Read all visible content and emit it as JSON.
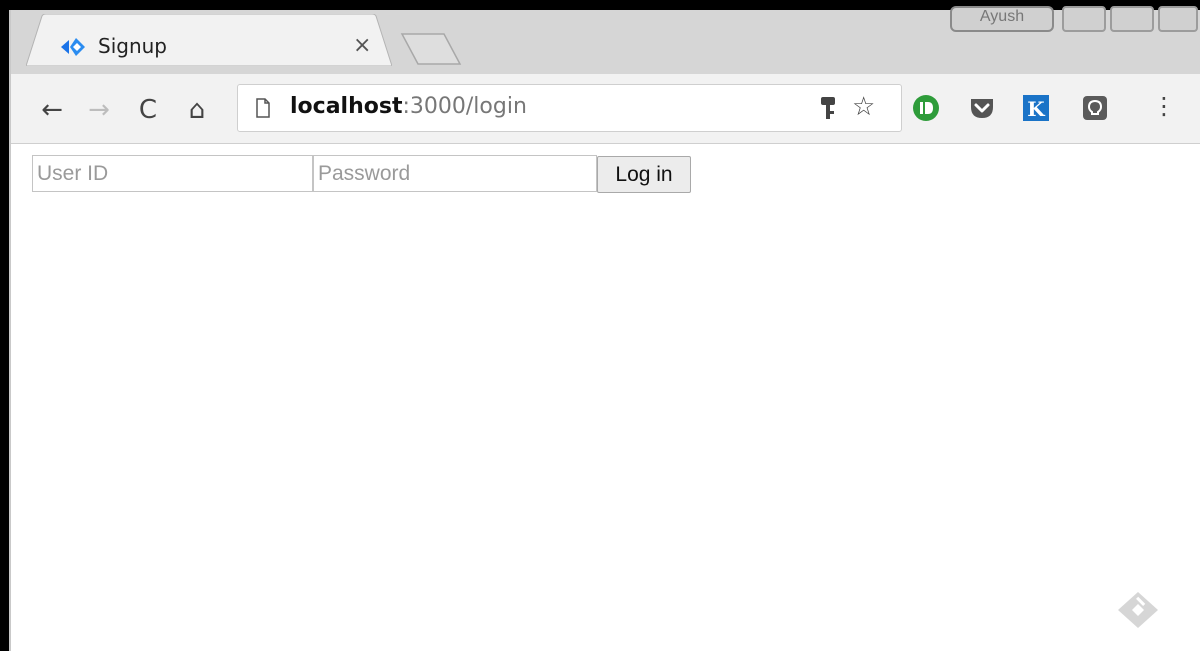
{
  "window": {
    "user_name": "Ayush"
  },
  "tab": {
    "title": "Signup",
    "close_glyph": "×",
    "favicon": "diamond-arrows-icon"
  },
  "toolbar": {
    "back_glyph": "←",
    "forward_glyph": "→",
    "reload_glyph": "C",
    "home_glyph": "⌂",
    "star_glyph": "☆",
    "menu_glyph": "⋮"
  },
  "address_bar": {
    "host": "localhost",
    "rest": ":3000/login"
  },
  "extensions": [
    {
      "name": "d-extension-icon",
      "color": "#2e9c3a",
      "glyph": "D"
    },
    {
      "name": "pocket-icon",
      "color": "#555555"
    },
    {
      "name": "k-extension-icon",
      "color": "#1a73c7",
      "glyph": "K"
    },
    {
      "name": "lightbulb-icon",
      "color": "#5a5a5a"
    }
  ],
  "form": {
    "user_placeholder": "User ID",
    "password_placeholder": "Password",
    "login_label": "Log in"
  },
  "colors": {
    "tabstrip": "#d6d6d6",
    "toolbar": "#f2f2f2",
    "favicon_blue": "#1a73e8"
  }
}
